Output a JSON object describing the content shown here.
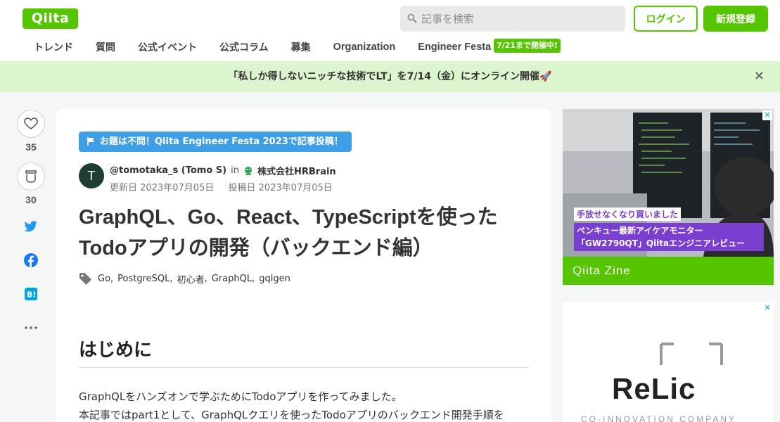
{
  "header": {
    "logo": "Qiita",
    "search_placeholder": "記事を検索",
    "login_label": "ログイン",
    "signup_label": "新規登録"
  },
  "nav": {
    "items": [
      "トレンド",
      "質問",
      "公式イベント",
      "公式コラム",
      "募集",
      "Organization",
      "Engineer Festa"
    ],
    "badge": "7/21まで開催中!"
  },
  "banner": {
    "text": "「私しか得しないニッチな技術でLT」を7/14（金）にオンライン開催🚀",
    "close": "×"
  },
  "rail": {
    "like_count": "35",
    "stock_count": "30"
  },
  "article": {
    "event_tag": "お題は不問！Qiita Engineer Festa 2023で記事投稿！",
    "avatar_letter": "T",
    "author": "@tomotaka_s (Tomo S)",
    "in": "in",
    "org": "株式会社HRBrain",
    "updated": "更新日 2023年07月05日",
    "posted": "投稿日 2023年07月05日",
    "title": "GraphQL、Go、React、TypeScriptを使ったTodoアプリの開発（バックエンド編）",
    "tags": [
      "Go",
      "PostgreSQL",
      "初心者",
      "GraphQL",
      "gqlgen"
    ],
    "heading": "はじめに",
    "para1": "GraphQLをハンズオンで学ぶためにTodoアプリを作ってみました。",
    "para2": "本記事ではpart1として、GraphQLクエリを使ったTodoアプリのバックエンド開発手順を"
  },
  "ads": {
    "ad1_label1": "手放せなくなり買いました",
    "ad1_label2": "ペンキュー最新アイケアモニター「GW2790QT」Qiitaエンジニアレビュー",
    "ad1_footer": "Qiita Zine",
    "ad2_logo": "ReLic",
    "ad2_sub": "CO-INNOVATION COMPANY"
  }
}
